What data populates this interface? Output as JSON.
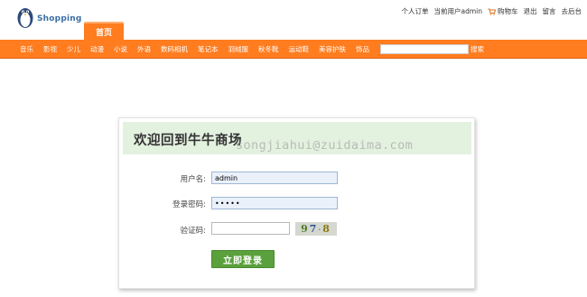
{
  "header": {
    "logo_text": "Shopping",
    "links": {
      "orders": "个人订单",
      "current_user": "当前用户admin",
      "cart": "购物车",
      "logout": "退出",
      "messages": "留言",
      "admin": "去后台"
    },
    "home_tab": "首页"
  },
  "nav": {
    "items": [
      "音乐",
      "影视",
      "少儿",
      "动漫",
      "小说",
      "外语",
      "数码相机",
      "笔记本",
      "羽绒服",
      "秋冬靴",
      "运动鞋",
      "美容护肤",
      "饰品"
    ],
    "search_value": "",
    "search_label": "搜索"
  },
  "login": {
    "title": "欢迎回到牛牛商场",
    "watermark": "songjiahui@zuidaima.com",
    "username_label": "用户名:",
    "username_value": "admin",
    "password_label": "登录密码:",
    "password_value": "•••••",
    "captcha_label": "验证码:",
    "captcha_value": "",
    "captcha_text": [
      "9",
      "7",
      "8"
    ],
    "submit_label": "立即登录"
  },
  "colors": {
    "accent": "#ff7c1f",
    "panel_header": "#e3f1df",
    "button": "#5aa03c"
  }
}
